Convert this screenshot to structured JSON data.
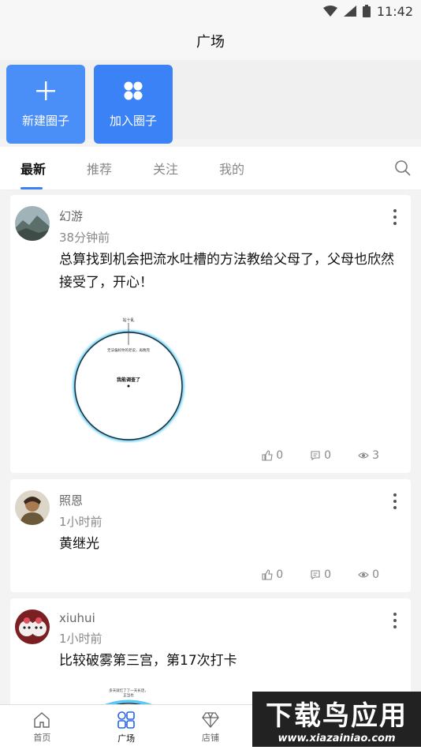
{
  "status_bar": {
    "time": "11:42"
  },
  "header": {
    "title": "广场"
  },
  "actions": [
    {
      "label": "新建圈子",
      "icon": "plus-icon"
    },
    {
      "label": "加入圈子",
      "icon": "join-circle-icon"
    }
  ],
  "tabs": [
    {
      "label": "最新",
      "active": true
    },
    {
      "label": "推荐",
      "active": false
    },
    {
      "label": "关注",
      "active": false
    },
    {
      "label": "我的",
      "active": false
    }
  ],
  "posts": [
    {
      "author": "幻游",
      "time": "38分钟前",
      "content": "总算找到机会把流水吐槽的方法教给父母了，父母也欣然接受了，开心！",
      "has_image": true,
      "image_texts": [
        "站十乱",
        "无法偏好你的老说，再晚完",
        "我能调查了"
      ],
      "likes": "0",
      "comments": "0",
      "views": "3"
    },
    {
      "author": "照恩",
      "time": "1小时前",
      "content": "黄继光",
      "has_image": false,
      "likes": "0",
      "comments": "0",
      "views": "0"
    },
    {
      "author": "xiuhui",
      "time": "1小时前",
      "content": "比较破雾第三宫，第17次打卡",
      "has_image": true,
      "image_texts": [
        "多天就忆了了一天长话，",
        "正当也"
      ]
    }
  ],
  "bottom_nav": [
    {
      "label": "首页",
      "icon": "home-icon"
    },
    {
      "label": "广场",
      "icon": "plaza-icon",
      "active": true
    },
    {
      "label": "店铺",
      "icon": "diamond-icon"
    },
    {
      "label": "",
      "icon": "message-icon"
    },
    {
      "label": "",
      "icon": "profile-icon"
    }
  ],
  "watermark": {
    "title": "下载鸟应用",
    "url": "www.xiazainiao.com"
  }
}
